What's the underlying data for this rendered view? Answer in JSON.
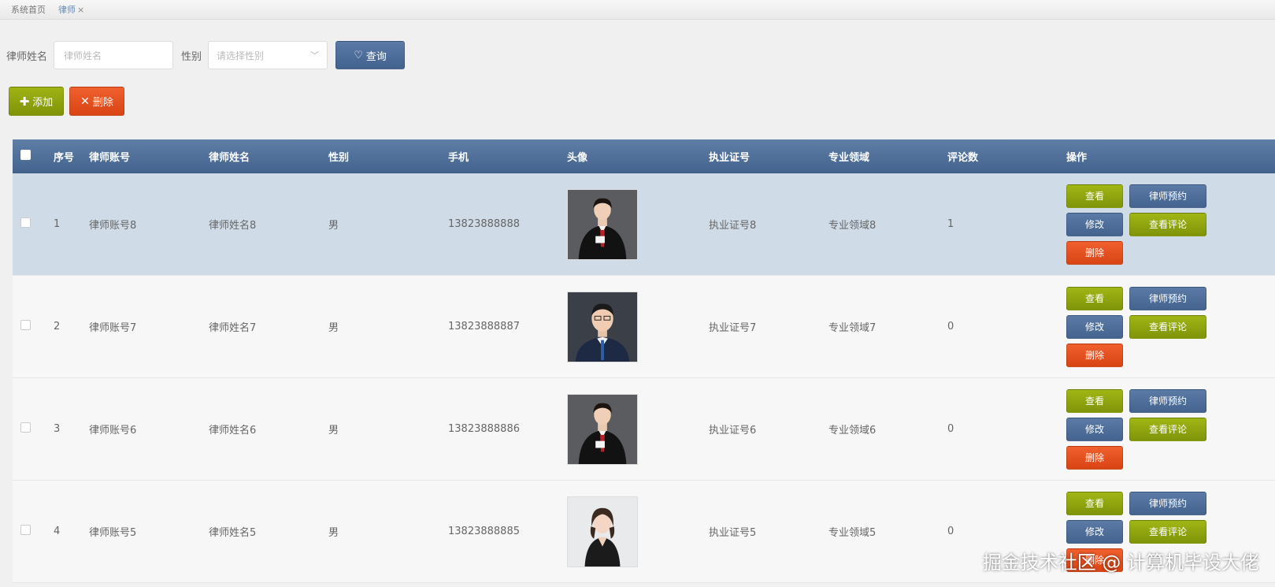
{
  "tabs": [
    {
      "label": "系统首页",
      "active": false
    },
    {
      "label": "律师",
      "active": true,
      "close": "×"
    }
  ],
  "search": {
    "name_label": "律师姓名",
    "name_placeholder": "律师姓名",
    "sex_label": "性别",
    "sex_placeholder": "请选择性别",
    "query_label": "查询"
  },
  "actions": {
    "add_label": "添加",
    "delete_label": "删除"
  },
  "table": {
    "headers": [
      "序号",
      "律师账号",
      "律师姓名",
      "性别",
      "手机",
      "头像",
      "执业证号",
      "专业领域",
      "评论数",
      "操作"
    ],
    "rows": [
      {
        "idx": "1",
        "account": "律师账号8",
        "name": "律师姓名8",
        "sex": "男",
        "phone": "13823888888",
        "license": "执业证号8",
        "field": "专业领域8",
        "comments": "1",
        "selected": true,
        "avatar": "female-lawyer-robe"
      },
      {
        "idx": "2",
        "account": "律师账号7",
        "name": "律师姓名7",
        "sex": "男",
        "phone": "13823888887",
        "license": "执业证号7",
        "field": "专业领域7",
        "comments": "0",
        "selected": false,
        "avatar": "male-suit"
      },
      {
        "idx": "3",
        "account": "律师账号6",
        "name": "律师姓名6",
        "sex": "男",
        "phone": "13823888886",
        "license": "执业证号6",
        "field": "专业领域6",
        "comments": "0",
        "selected": false,
        "avatar": "female-lawyer-robe"
      },
      {
        "idx": "4",
        "account": "律师账号5",
        "name": "律师姓名5",
        "sex": "男",
        "phone": "13823888885",
        "license": "执业证号5",
        "field": "专业领域5",
        "comments": "0",
        "selected": false,
        "avatar": "female-black-dress"
      }
    ],
    "ops": {
      "view": "查看",
      "reserve": "律师预约",
      "edit": "修改",
      "view_comments": "查看评论",
      "delete": "删除"
    }
  },
  "watermark": "掘金技术社区 @ 计算机毕设大佬",
  "colors": {
    "header_blue": "#4f6f99",
    "olive": "#8fa40e",
    "red": "#e4501f",
    "selected_row": "#cfdbe6"
  }
}
